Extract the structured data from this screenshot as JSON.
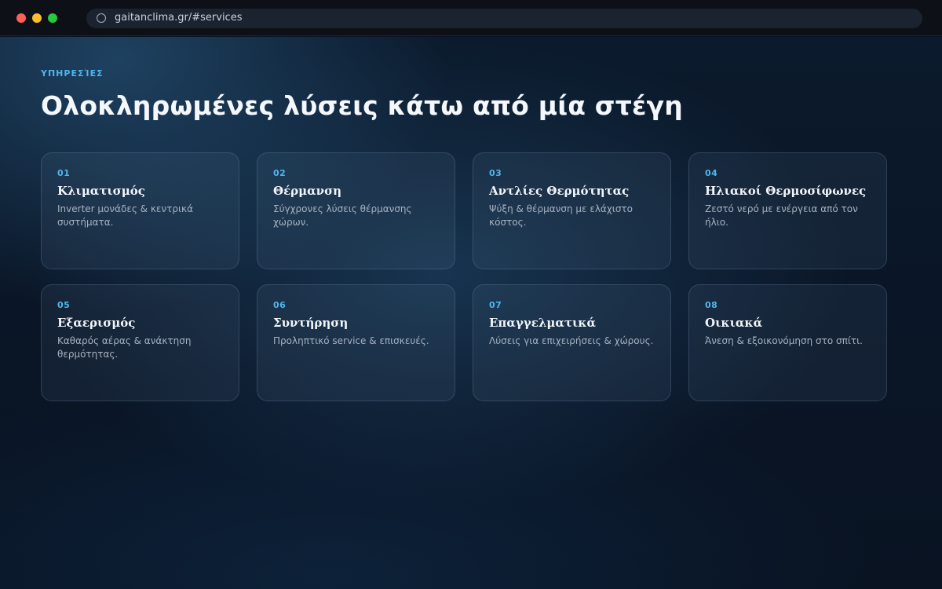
{
  "browser": {
    "url": "gaitanclima.gr/#services"
  },
  "section": {
    "eyebrow": "ΥΠΗΡΕΣΊΕΣ",
    "heading": "Ολοκληρωμένες λύσεις κάτω από μία στέγη"
  },
  "services": [
    {
      "num": "01",
      "title": "Κλιματισμός",
      "desc": "Inverter μονάδες & κεντρικά συστήματα."
    },
    {
      "num": "02",
      "title": "Θέρμανση",
      "desc": "Σύγχρονες λύσεις θέρμανσης χώρων."
    },
    {
      "num": "03",
      "title": "Αντλίες Θερμότητας",
      "desc": "Ψύξη & θέρμανση με ελάχιστο κόστος."
    },
    {
      "num": "04",
      "title": "Ηλιακοί Θερμοσίφωνες",
      "desc": "Ζεστό νερό με ενέργεια από τον ήλιο."
    },
    {
      "num": "05",
      "title": "Εξαερισμός",
      "desc": "Καθαρός αέρας & ανάκτηση θερμότητας."
    },
    {
      "num": "06",
      "title": "Συντήρηση",
      "desc": "Προληπτικό service & επισκευές."
    },
    {
      "num": "07",
      "title": "Επαγγελματικά",
      "desc": "Λύσεις για επιχειρήσεις & χώρους."
    },
    {
      "num": "08",
      "title": "Οικιακά",
      "desc": "Άνεση & εξοικονόμηση στο σπίτι."
    }
  ],
  "colors": {
    "accent": "#4fb6ee",
    "background": "#0a1424",
    "card_border": "#3a4b60"
  }
}
